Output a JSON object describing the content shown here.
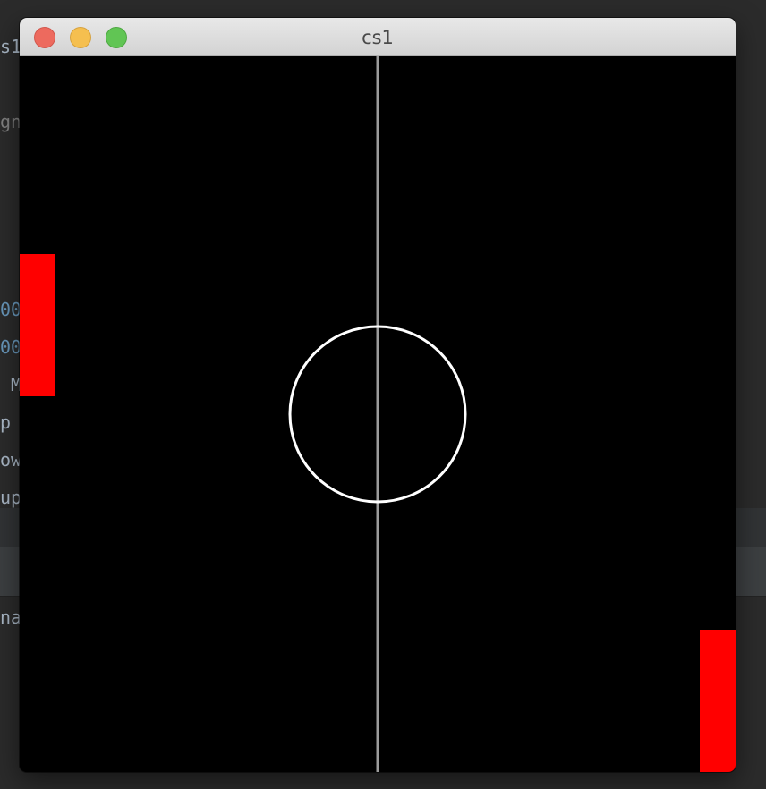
{
  "background_editor": {
    "lines": [
      {
        "text": "s1",
        "style": "plain"
      },
      {
        "text": "gn",
        "style": "dim"
      },
      {
        "text": "00",
        "style": "num"
      },
      {
        "text": "00",
        "style": "num"
      },
      {
        "text": "_M",
        "style": "plain"
      },
      {
        "text": "p",
        "style": "plain"
      },
      {
        "text": "ow",
        "style": "plain"
      },
      {
        "text": "up",
        "style": "plain"
      },
      {
        "text": "na",
        "style": "plain"
      }
    ]
  },
  "window": {
    "title": "cs1",
    "controls": {
      "close": "close-button",
      "minimize": "minimize-button",
      "zoom": "zoom-button"
    }
  },
  "game": {
    "background_color": "#000000",
    "midline_color": "#9b9b9b",
    "center_circle_color": "#ffffff",
    "paddle_color": "#ff0000"
  }
}
